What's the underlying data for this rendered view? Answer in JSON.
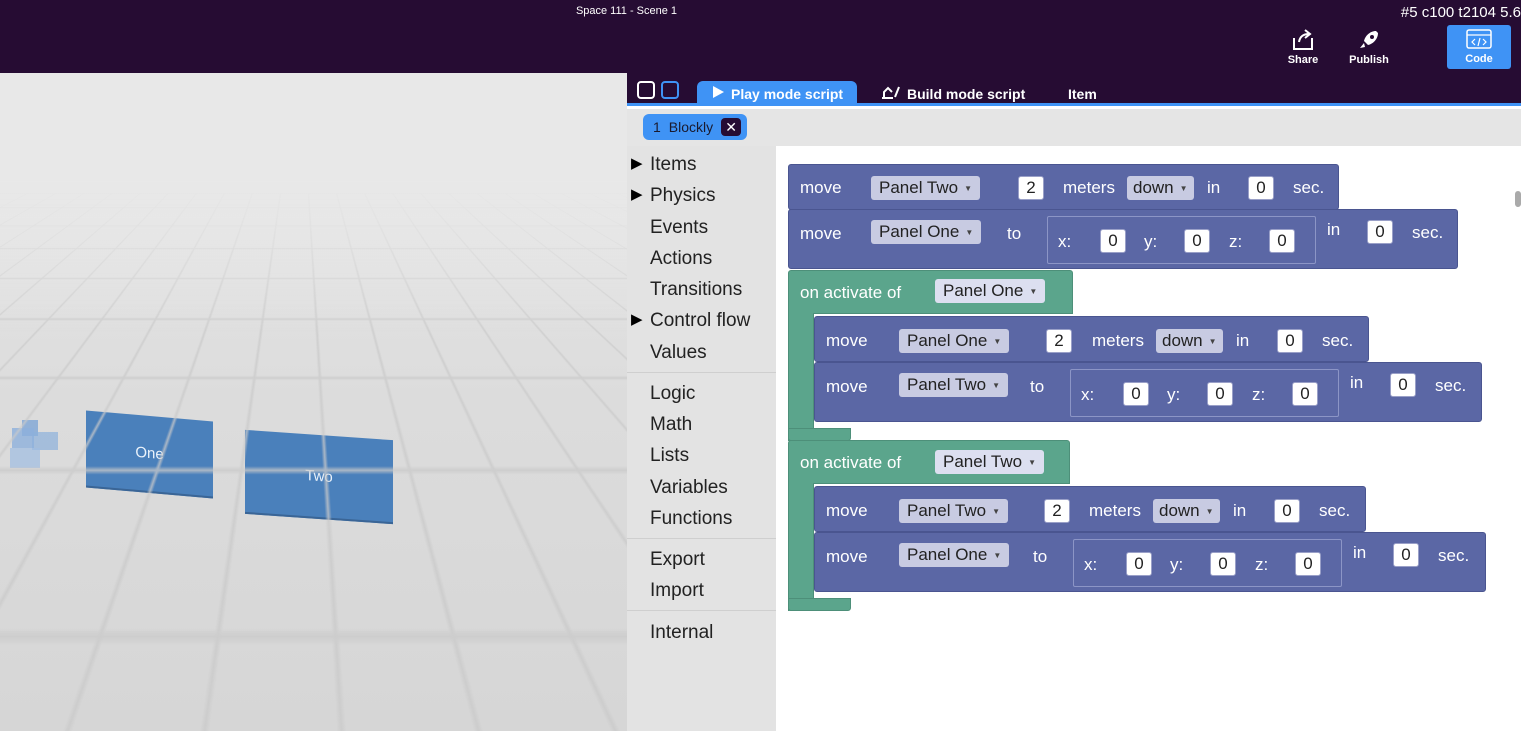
{
  "topbar": {
    "title": "Space 111 - Scene 1",
    "stats": "#5  c100 t2104 5.6",
    "share_label": "Share",
    "publish_label": "Publish",
    "code_label": "Code"
  },
  "viewport": {
    "panels": [
      {
        "label": "One"
      },
      {
        "label": "Two"
      }
    ]
  },
  "tabs": {
    "play": "Play mode script",
    "build": "Build mode script",
    "item": "Item"
  },
  "script_chip": {
    "index": "1",
    "name": "Blockly",
    "close": "✕"
  },
  "toolbox": {
    "categories": [
      "Items",
      "Physics",
      "Events",
      "Actions",
      "Transitions",
      "Control flow",
      "Values",
      "Logic",
      "Math",
      "Lists",
      "Variables",
      "Functions",
      "Export",
      "Import",
      "Internal"
    ]
  },
  "blocks": {
    "move": "move",
    "meters": "meters",
    "in": "in",
    "sec": "sec.",
    "to": "to",
    "x": "x:",
    "y": "y:",
    "z": "z:",
    "down": "down",
    "on_activate": "on activate of",
    "panel_one": "Panel One",
    "panel_two": "Panel Two",
    "two": "2",
    "zero": "0"
  }
}
